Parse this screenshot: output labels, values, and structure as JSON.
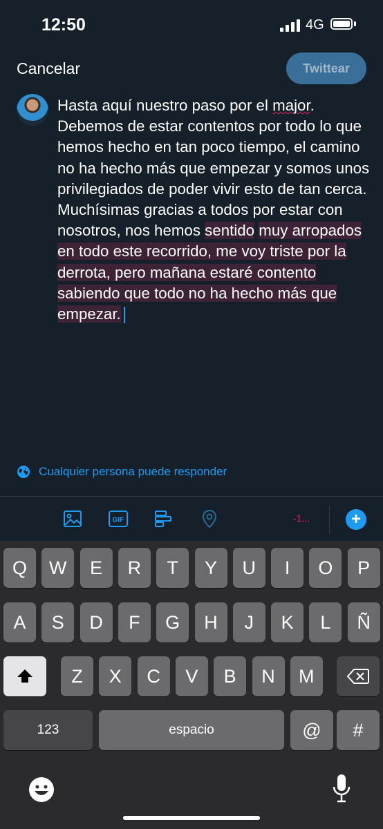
{
  "status": {
    "time": "12:50",
    "network": "4G"
  },
  "header": {
    "cancel_label": "Cancelar",
    "tweet_label": "Twittear"
  },
  "tweet": {
    "text_before": "Hasta aquí nuestro paso por el ",
    "misspelled": "major",
    "text_mid": ". Debemos de estar contentos por todo lo que hemos hecho en tan poco tiempo, el camino no ha hecho más que empezar y somos unos privilegiados de poder vivir esto de tan cerca. Muchísimas gracias a todos por estar con nosotros, nos hemos ",
    "text_highlight_1": "sentido",
    "text_highlight_2": "muy arropados en todo este recorrido, me voy triste por la derrota, pero mañana estaré contento sabiendo que todo no ha hecho más que empezar."
  },
  "reply_setting": "Cualquier persona puede responder",
  "toolbar": {
    "icons": [
      "audio-wave-icon",
      "image-icon",
      "gif-icon",
      "poll-icon",
      "location-icon"
    ],
    "counter": "-1...",
    "add_label": "+"
  },
  "keyboard": {
    "row1": [
      "Q",
      "W",
      "E",
      "R",
      "T",
      "Y",
      "U",
      "I",
      "O",
      "P"
    ],
    "row2": [
      "A",
      "S",
      "D",
      "F",
      "G",
      "H",
      "J",
      "K",
      "L",
      "Ñ"
    ],
    "row3": [
      "Z",
      "X",
      "C",
      "V",
      "B",
      "N",
      "M"
    ],
    "numbers_label": "123",
    "space_label": "espacio",
    "at_label": "@",
    "hash_label": "#"
  },
  "colors": {
    "background": "#15202b",
    "accent": "#1d9bf0",
    "highlight": "#3e2235",
    "counter": "#e0245e"
  }
}
